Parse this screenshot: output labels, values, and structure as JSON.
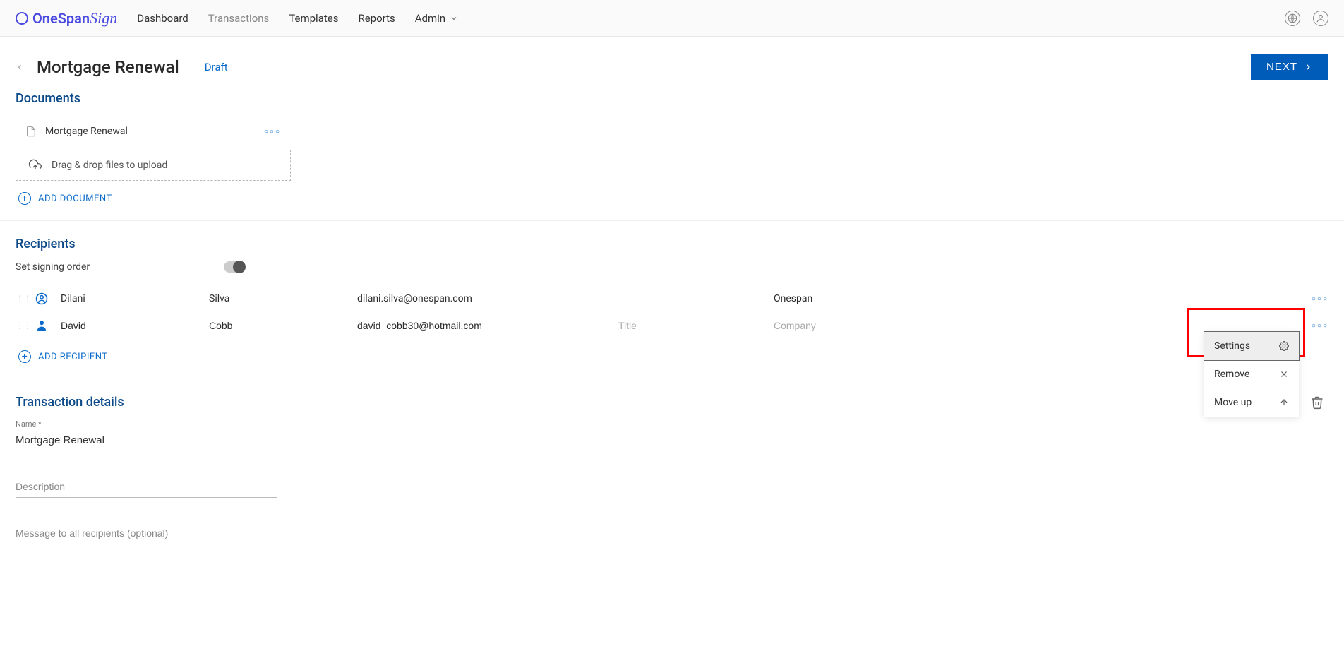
{
  "brand": {
    "name": "OneSpan",
    "suffix": "Sign"
  },
  "nav": {
    "items": [
      "Dashboard",
      "Transactions",
      "Templates",
      "Reports",
      "Admin"
    ],
    "activeIndex": 1
  },
  "page": {
    "title": "Mortgage Renewal",
    "status": "Draft",
    "next": "NEXT"
  },
  "documents": {
    "title": "Documents",
    "items": [
      {
        "name": "Mortgage Renewal"
      }
    ],
    "dropzone": "Drag & drop files to upload",
    "addLabel": "ADD DOCUMENT"
  },
  "recipients": {
    "title": "Recipients",
    "setOrderLabel": "Set signing order",
    "addLabel": "ADD RECIPIENT",
    "rows": [
      {
        "first": "Dilani",
        "last": "Silva",
        "email": "dilani.silva@onespan.com",
        "title": "",
        "company": "Onespan",
        "self": true
      },
      {
        "first": "David",
        "last": "Cobb",
        "email": "david_cobb30@hotmail.com",
        "title": "",
        "company": "",
        "self": false
      }
    ],
    "placeholders": {
      "title": "Title",
      "company": "Company"
    },
    "menu": {
      "settings": "Settings",
      "remove": "Remove",
      "moveUp": "Move up"
    }
  },
  "transaction": {
    "title": "Transaction details",
    "nameLabel": "Name *",
    "nameValue": "Mortgage Renewal",
    "descriptionPlaceholder": "Description",
    "messagePlaceholder": "Message to all recipients (optional)"
  }
}
